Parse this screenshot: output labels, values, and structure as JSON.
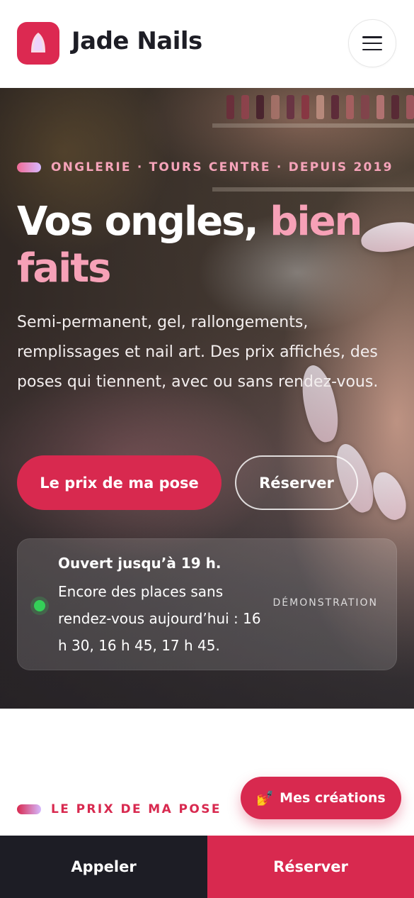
{
  "header": {
    "brand": "Jade Nails",
    "logo_icon": "nail-icon",
    "menu_icon": "hamburger-icon",
    "colors": {
      "accent": "#d8294f",
      "text": "#1d1d25"
    }
  },
  "hero": {
    "eyebrow": "ONGLERIE · TOURS CENTRE · DEPUIS 2019",
    "title_main": "Vos ongles, ",
    "title_accent": "bien faits",
    "description": "Semi-permanent, gel, rallongements, remplissages et nail art. Des prix affichés, des poses qui tiennent, avec ou sans rendez-vous.",
    "primary_button": "Le prix de ma pose",
    "secondary_button": "Réserver",
    "status": {
      "title": "Ouvert jusqu’à 19 h.",
      "text": "Encore des places sans rendez-vous aujourd’hui : 16 h 30, 16 h 45, 17 h 45.",
      "tag": "DÉMONSTRATION",
      "dot_color": "#34d058"
    }
  },
  "section": {
    "eyebrow": "LE PRIX DE MA POSE"
  },
  "fab": {
    "icon": "nail-polish-emoji",
    "emoji": "💅",
    "label": "Mes créations"
  },
  "bottom_bar": {
    "call": "Appeler",
    "book": "Réserver"
  }
}
